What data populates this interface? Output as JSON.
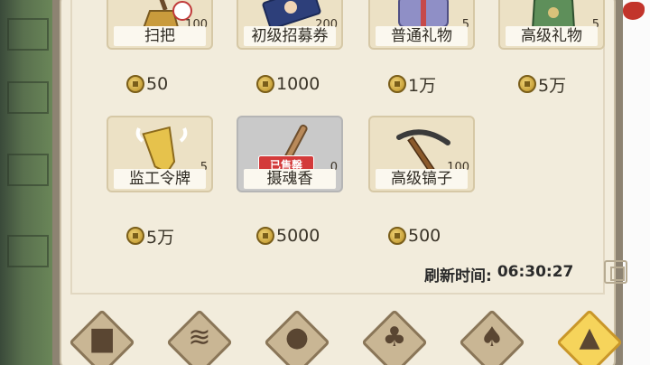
{
  "shop": {
    "items": [
      {
        "name": "扫把",
        "count": "100",
        "price": "50",
        "icon": "broom-icon"
      },
      {
        "name": "初级招募券",
        "count": "200",
        "price": "1000",
        "icon": "recruit-ticket-icon"
      },
      {
        "name": "普通礼物",
        "count": "5",
        "price": "1万",
        "icon": "gift-box-icon"
      },
      {
        "name": "高级礼物",
        "count": "5",
        "price": "5万",
        "icon": "gift-bag-icon"
      },
      {
        "name": "监工令牌",
        "count": "5",
        "price": "5万",
        "icon": "token-icon"
      },
      {
        "name": "摄魂香",
        "count": "0",
        "price": "5000",
        "icon": "incense-icon",
        "sold_label": "已售罄"
      },
      {
        "name": "高级镐子",
        "count": "100",
        "price": "500",
        "icon": "pickaxe-icon"
      }
    ],
    "refresh_label": "刷新时间:",
    "refresh_time": "06:30:27"
  },
  "nav": {
    "tabs": [
      {
        "icon": "seed-bag-icon",
        "active": false
      },
      {
        "icon": "fish-icon",
        "active": false
      },
      {
        "icon": "pig-icon",
        "active": false
      },
      {
        "icon": "feed-bag-icon",
        "active": false
      },
      {
        "icon": "teapot-icon",
        "active": false
      },
      {
        "icon": "hammer-icon",
        "active": true
      }
    ]
  },
  "colors": {
    "panel_bg": "#f2ecdc",
    "card_bg": "#ece1c5",
    "sold_stamp": "#d33a3a",
    "active_tab": "#f6d45b"
  }
}
